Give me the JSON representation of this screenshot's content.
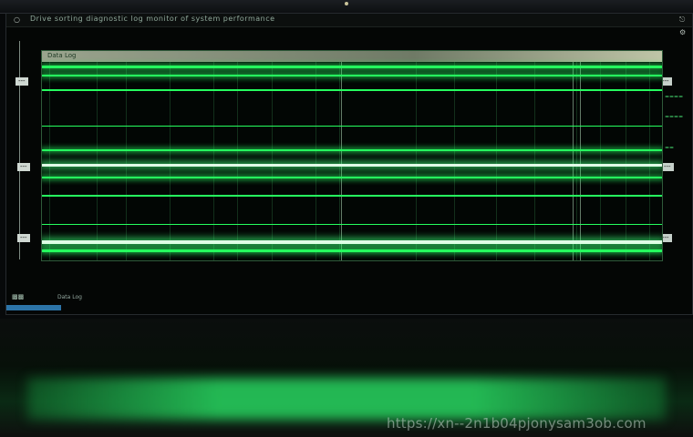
{
  "window": {
    "title": "Drive sorting diagnostic log monitor of system performance",
    "lock_icon": "lock-icon",
    "close_icon": "power-icon",
    "minimize_icon": "settings-icon"
  },
  "panel": {
    "header": "Data Log"
  },
  "side_labels": {
    "left_top": "---",
    "left_mid": "---",
    "left_bottom": "---",
    "right_top": "---",
    "right_mid": "---",
    "right_bottom": "---"
  },
  "side_tags": [
    "====",
    "====",
    "=="
  ],
  "status": {
    "icon": "status-icon",
    "text": "Data Log"
  },
  "watermark": "https://xn--2n1b04pjonysam3ob.com",
  "colors": {
    "trace": "#25ff5e",
    "trace_highlight": "#dfffe6",
    "background": "#040605",
    "taskbar": "#2c74a8"
  }
}
